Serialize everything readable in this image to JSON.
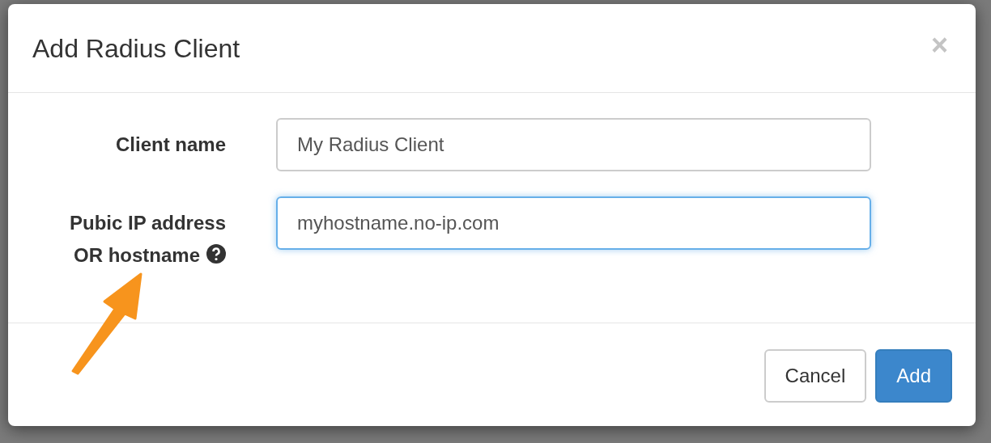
{
  "modal": {
    "title": "Add Radius Client",
    "close": "×"
  },
  "fields": [
    {
      "label": "Client name",
      "value": "My Radius Client",
      "focused": false,
      "help": false
    },
    {
      "label": "Pubic IP address OR hostname",
      "value": "myhostname.no-ip.com",
      "focused": true,
      "help": true
    }
  ],
  "buttons": [
    {
      "label": "Cancel",
      "kind": "default"
    },
    {
      "label": "Add",
      "kind": "primary"
    }
  ]
}
